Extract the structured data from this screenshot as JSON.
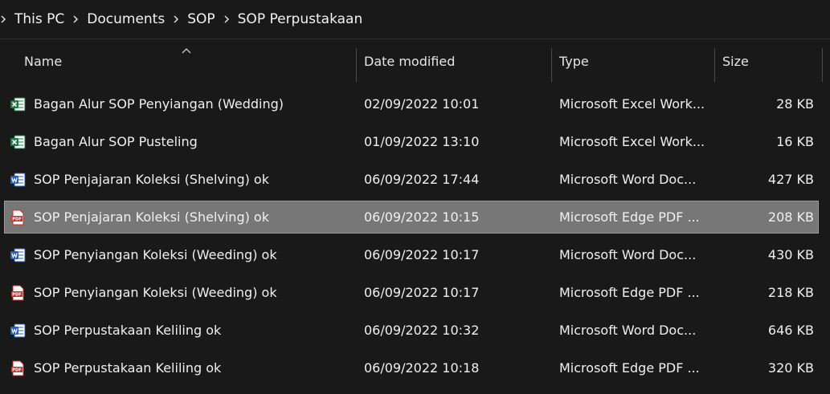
{
  "breadcrumb": {
    "items": [
      "This PC",
      "Documents",
      "SOP",
      "SOP Perpustakaan"
    ]
  },
  "columns": {
    "name": "Name",
    "date": "Date modified",
    "type": "Type",
    "size": "Size"
  },
  "icons": {
    "excel": "excel-file-icon",
    "word": "word-file-icon",
    "pdf": "pdf-file-icon"
  },
  "colors": {
    "background": "#191919",
    "selected_row": "#777777",
    "excel_green": "#1d7a44",
    "word_blue": "#2b5fb4",
    "pdf_red": "#c8302b"
  },
  "files": [
    {
      "name": "Bagan Alur SOP Penyiangan (Wedding)",
      "date": "02/09/2022 10:01",
      "type": "Microsoft Excel Work...",
      "size": "28 KB",
      "icon": "excel"
    },
    {
      "name": "Bagan Alur SOP Pusteling",
      "date": "01/09/2022 13:10",
      "type": "Microsoft Excel Work...",
      "size": "16 KB",
      "icon": "excel"
    },
    {
      "name": "SOP Penjajaran Koleksi (Shelving) ok",
      "date": "06/09/2022 17:44",
      "type": "Microsoft Word Doc...",
      "size": "427 KB",
      "icon": "word"
    },
    {
      "name": "SOP Penjajaran Koleksi (Shelving) ok",
      "date": "06/09/2022 10:15",
      "type": "Microsoft Edge PDF ...",
      "size": "208 KB",
      "icon": "pdf",
      "selected": true
    },
    {
      "name": "SOP Penyiangan Koleksi (Weeding) ok",
      "date": "06/09/2022 10:17",
      "type": "Microsoft Word Doc...",
      "size": "430 KB",
      "icon": "word"
    },
    {
      "name": "SOP Penyiangan Koleksi (Weeding) ok",
      "date": "06/09/2022 10:17",
      "type": "Microsoft Edge PDF ...",
      "size": "218 KB",
      "icon": "pdf"
    },
    {
      "name": "SOP Perpustakaan Keliling ok",
      "date": "06/09/2022 10:32",
      "type": "Microsoft Word Doc...",
      "size": "646 KB",
      "icon": "word"
    },
    {
      "name": "SOP Perpustakaan Keliling ok",
      "date": "06/09/2022 10:18",
      "type": "Microsoft Edge PDF ...",
      "size": "320 KB",
      "icon": "pdf"
    }
  ]
}
